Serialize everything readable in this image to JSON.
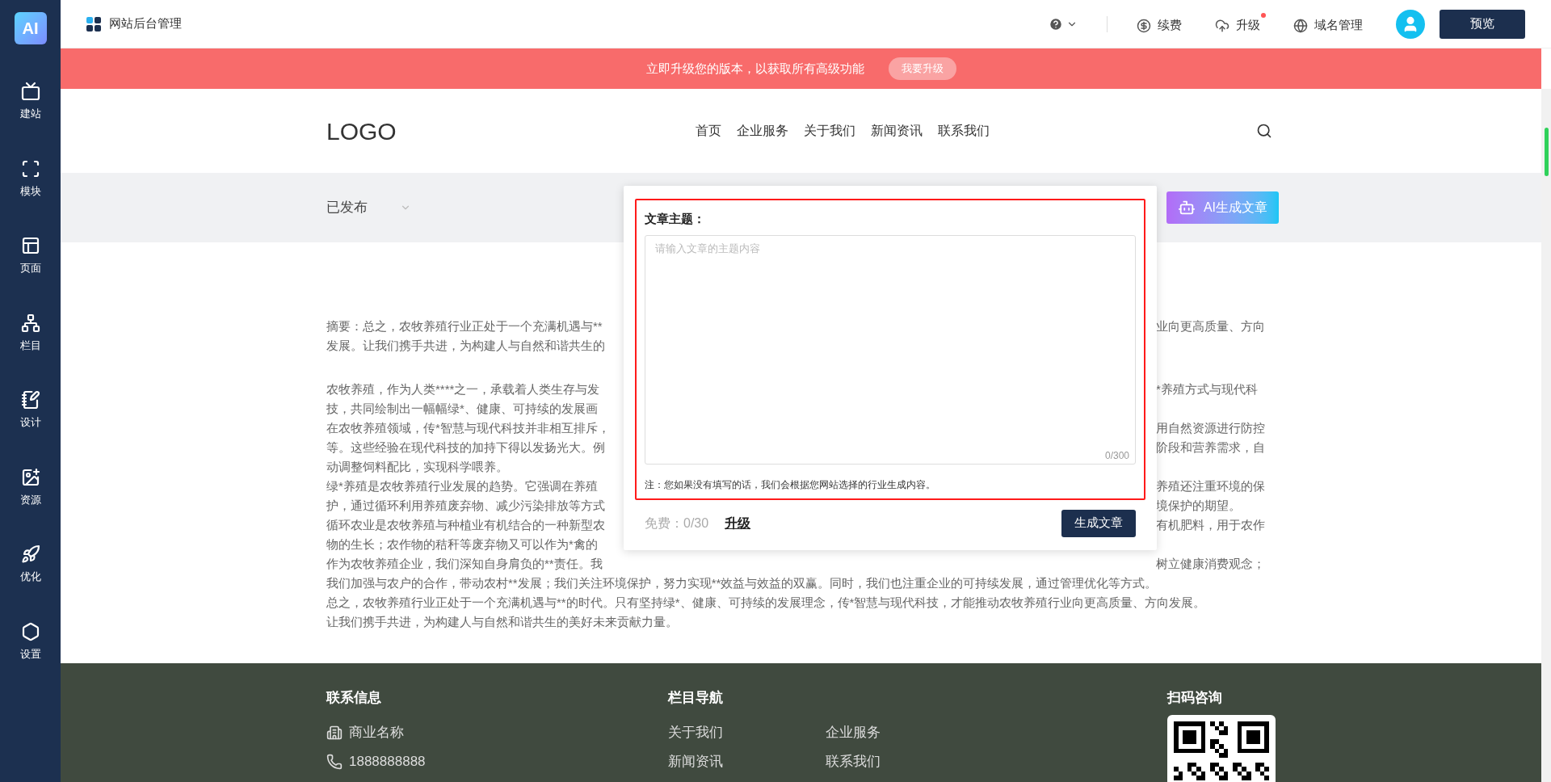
{
  "sidebar": {
    "logo_text": "AI",
    "items": [
      {
        "label": "建站"
      },
      {
        "label": "模块"
      },
      {
        "label": "页面"
      },
      {
        "label": "栏目"
      },
      {
        "label": "设计"
      },
      {
        "label": "资源"
      },
      {
        "label": "优化"
      },
      {
        "label": "设置"
      }
    ]
  },
  "topbar": {
    "title": "网站后台管理",
    "actions": [
      {
        "label": "续费",
        "dot": false
      },
      {
        "label": "升级",
        "dot": true
      },
      {
        "label": "域名管理",
        "dot": false
      }
    ],
    "preview_button": "预览"
  },
  "banner": {
    "text": "立即升级您的版本，以获取所有高级功能",
    "button": "我要升级"
  },
  "site_header": {
    "logo": "LOGO",
    "nav": [
      "首页",
      "企业服务",
      "关于我们",
      "新闻资讯",
      "联系我们"
    ]
  },
  "toolbar": {
    "status": "已发布",
    "ai_button": "AI生成文章"
  },
  "article": {
    "summary": [
      {
        "kind": "split",
        "left": "摘要：总之，农牧养殖行业正处于一个充满机遇与**",
        "right": "业向更高质量、方向"
      },
      {
        "kind": "split",
        "left": "发展。让我们携手共进，为构建人与自然和谐共生的"
      }
    ],
    "body": [
      {
        "kind": "split",
        "left": "农牧养殖，作为人类****之一，承载着人类生存与发",
        "right": "*养殖方式与现代科"
      },
      {
        "kind": "split",
        "left": "技，共同绘制出一幅幅绿*、健康、可持续的发展画"
      },
      {
        "kind": "split",
        "left": "在农牧养殖领域，传*智慧与现代科技并非相互排斥，",
        "right": "用自然资源进行防控"
      },
      {
        "kind": "split",
        "left": "等。这些经验在现代科技的加持下得以发扬光大。例",
        "right": "阶段和营养需求，自"
      },
      {
        "kind": "full",
        "text": "动调整饲料配比，实现科学喂养。"
      },
      {
        "kind": "split",
        "left": "绿*养殖是农牧养殖行业发展的趋势。它强调在养殖",
        "right": "养殖还注重环境的保"
      },
      {
        "kind": "split",
        "left": "护，通过循环利用养殖废弃物、减少污染排放等方式",
        "right": "境保护的期望。"
      },
      {
        "kind": "split",
        "left": "循环农业是农牧养殖与种植业有机结合的一种新型农",
        "right": "有机肥料，用于农作"
      },
      {
        "kind": "split",
        "left": "物的生长；农作物的秸秆等废弃物又可以作为*禽的"
      },
      {
        "kind": "split",
        "left": "作为农牧养殖企业，我们深知自身肩负的**责任。我",
        "right": "树立健康消费观念；"
      },
      {
        "kind": "full",
        "text": "我们加强与农户的合作，带动农村**发展；我们关注环境保护，努力实现**效益与效益的双赢。同时，我们也注重企业的可持续发展，通过管理优化等方式。"
      },
      {
        "kind": "full",
        "text": "总之，农牧养殖行业正处于一个充满机遇与**的时代。只有坚持绿*、健康、可持续的发展理念，传*智慧与现代科技，才能推动农牧养殖行业向更高质量、方向发展。"
      },
      {
        "kind": "full",
        "text": "让我们携手共进，为构建人与自然和谐共生的美好未来贡献力量。"
      }
    ]
  },
  "popup": {
    "label": "文章主题：",
    "placeholder": "请输入文章的主题内容",
    "counter": "0/300",
    "note": "注：您如果没有填写的话，我们会根据您网站选择的行业生成内容。",
    "quota": "免费：0/30",
    "upgrade_link": "升级",
    "generate_button": "生成文章"
  },
  "footer": {
    "contact": {
      "heading": "联系信息",
      "items": [
        {
          "text": "商业名称"
        },
        {
          "text": "1888888888"
        }
      ]
    },
    "nav": {
      "heading": "栏目导航",
      "links": [
        "关于我们",
        "企业服务",
        "新闻资讯",
        "联系我们"
      ]
    },
    "qr": {
      "heading": "扫码咨询"
    }
  }
}
